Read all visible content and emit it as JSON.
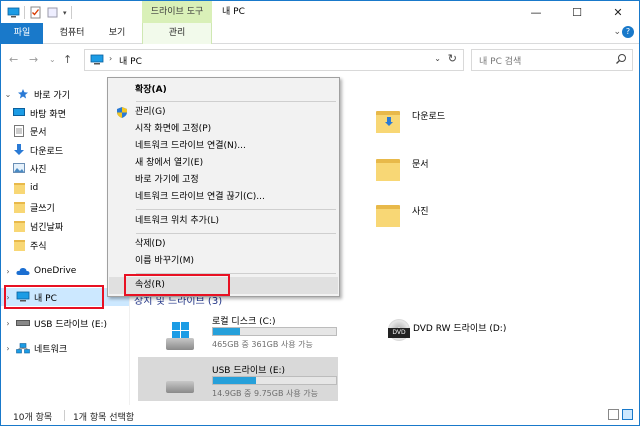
{
  "titlebar": {
    "context_tool_title": "드라이브 도구",
    "window_title": "내 PC",
    "minimize": "—",
    "maximize": "☐",
    "close": "✕"
  },
  "tabs": {
    "file": "파일",
    "computer": "컴퓨터",
    "view": "보기",
    "manage": "관리"
  },
  "address": {
    "crumb": "내 PC",
    "search_placeholder": "내 PC 검색"
  },
  "nav": {
    "quick_access": "바로 가기",
    "desktop": "바탕 화면",
    "documents": "문서",
    "downloads": "다운로드",
    "pictures": "사진",
    "folder_id": "id",
    "folder_writing": "글쓰기",
    "folder_long": "넘긴날짜",
    "folder_stocks": "주식",
    "onedrive": "OneDrive",
    "this_pc": "내 PC",
    "usb": "USB 드라이브 (E:)",
    "network": "네트워크"
  },
  "content": {
    "folders": [
      {
        "label": "다운로드"
      },
      {
        "label": "문서"
      },
      {
        "label": "사진"
      }
    ],
    "section_heading": "장치 및 드라이브 (3)",
    "drives": [
      {
        "name": "로컬 디스크 (C:)",
        "capacity": "465GB 중 361GB 사용 가능",
        "used_fraction": 0.22
      },
      {
        "name": "DVD RW 드라이브 (D:)"
      },
      {
        "name": "USB 드라이브 (E:)",
        "capacity": "14.9GB 중 9.75GB 사용 가능",
        "used_fraction": 0.35
      }
    ]
  },
  "context_menu": {
    "expand": "확장(A)",
    "manage": "관리(G)",
    "pin_start": "시작 화면에 고정(P)",
    "map_drive": "네트워크 드라이브 연결(N)...",
    "open_new_window": "새 창에서 열기(E)",
    "pin_quick": "바로 가기에 고정",
    "disconnect_drive": "네트워크 드라이브 연결 끊기(C)...",
    "add_network_location": "네트워크 위치 추가(L)",
    "delete": "삭제(D)",
    "rename": "이름 바꾸기(M)",
    "properties": "속성(R)"
  },
  "status": {
    "item_count": "10개 항목",
    "selected": "1개 항목 선택함"
  },
  "colors": {
    "accent": "#1979ca",
    "highlight_box": "#e81123",
    "context_tab": "#d9f0b8",
    "drive_fill": "#26a0da"
  }
}
